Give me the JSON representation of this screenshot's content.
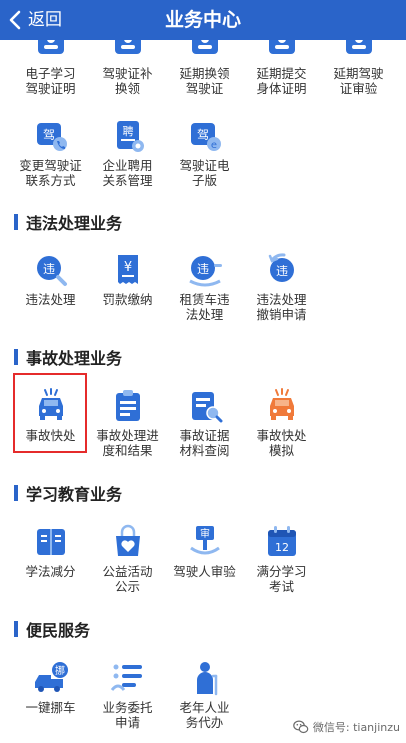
{
  "header": {
    "back_label": "返回",
    "title": "业务中心",
    "bg_color": "#2a64c9"
  },
  "rows": {
    "row1": [
      {
        "label": "电子学习\n驾驶证明",
        "icon": "card-id-icon"
      },
      {
        "label": "驾驶证补\n换领",
        "icon": "card-id-icon"
      },
      {
        "label": "延期换领\n驾驶证",
        "icon": "card-id-icon"
      },
      {
        "label": "延期提交\n身体证明",
        "icon": "card-id-icon"
      },
      {
        "label": "延期驾驶\n证审验",
        "icon": "card-id-icon"
      }
    ],
    "row2": [
      {
        "label": "变更驾驶证\n联系方式",
        "icon": "license-phone-icon",
        "glyph": "驾"
      },
      {
        "label": "企业聘用\n关系管理",
        "icon": "hire-doc-icon",
        "glyph": "聘"
      },
      {
        "label": "驾驶证电\n子版",
        "icon": "license-e-icon",
        "glyph": "驾"
      }
    ]
  },
  "sections": [
    {
      "title": "违法处理业务",
      "items": [
        {
          "label": "违法处理",
          "icon": "violation-search-icon",
          "glyph": "违"
        },
        {
          "label": "罚款缴纳",
          "icon": "fine-receipt-icon",
          "glyph": "¥"
        },
        {
          "label": "租赁车违\n法处理",
          "icon": "rental-violation-icon",
          "glyph": "违"
        },
        {
          "label": "违法处理\n撤销申请",
          "icon": "violation-revoke-icon",
          "glyph": "违"
        }
      ]
    },
    {
      "title": "事故处理业务",
      "items": [
        {
          "label": "事故快处",
          "icon": "car-accident-icon"
        },
        {
          "label": "事故处理进\n度和结果",
          "icon": "clipboard-list-icon"
        },
        {
          "label": "事故证据\n材料查阅",
          "icon": "evidence-search-icon"
        },
        {
          "label": "事故快处\n模拟",
          "icon": "car-accident-orange-icon"
        }
      ]
    },
    {
      "title": "学习教育业务",
      "items": [
        {
          "label": "学法减分",
          "icon": "open-book-icon"
        },
        {
          "label": "公益活动\n公示",
          "icon": "heart-hand-bag-icon"
        },
        {
          "label": "驾驶人审验",
          "icon": "review-sign-icon",
          "glyph": "审"
        },
        {
          "label": "满分学习\n考试",
          "icon": "calendar-12-icon",
          "glyph": "12"
        }
      ]
    },
    {
      "title": "便民服务",
      "items": [
        {
          "label": "一键挪车",
          "icon": "tow-truck-icon",
          "glyph": "挪"
        },
        {
          "label": "业务委托\n申请",
          "icon": "delegate-list-icon"
        },
        {
          "label": "老年人业\n务代办",
          "icon": "elderly-person-icon"
        }
      ]
    }
  ],
  "watermark": {
    "text": "微信号: tianjinzu",
    "icon": "wechat-icon"
  },
  "colors": {
    "accent": "#2a64c9",
    "icon_blue": "#2f6fd6",
    "icon_light": "#8fb8f0",
    "orange": "#f07a3a",
    "highlight_red": "#e52b2b"
  }
}
